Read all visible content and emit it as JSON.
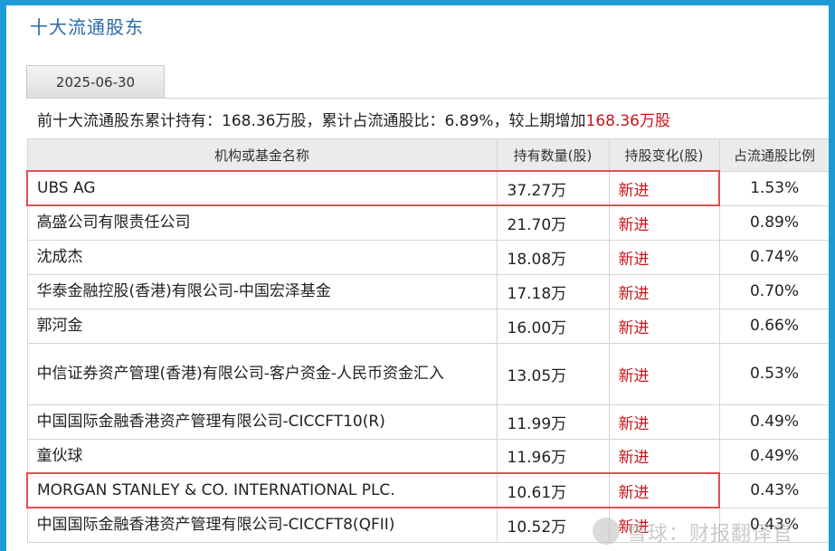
{
  "section_title": "十大流通股东",
  "tab_label": "2025-06-30",
  "summary": {
    "prefix": "前十大流通股东累计持有：168.36万股，累计占流通股比：6.89%，较上期增加",
    "highlight": "168.36万股"
  },
  "table": {
    "headers": [
      "机构或基金名称",
      "持有数量(股)",
      "持股变化(股)",
      "占流通股比例"
    ],
    "rows": [
      {
        "name": "UBS AG",
        "qty": "37.27万",
        "change": "新进",
        "pct": "1.53%"
      },
      {
        "name": "高盛公司有限责任公司",
        "qty": "21.70万",
        "change": "新进",
        "pct": "0.89%"
      },
      {
        "name": "沈成杰",
        "qty": "18.08万",
        "change": "新进",
        "pct": "0.74%"
      },
      {
        "name": "华泰金融控股(香港)有限公司-中国宏泽基金",
        "qty": "17.18万",
        "change": "新进",
        "pct": "0.70%"
      },
      {
        "name": "郭河金",
        "qty": "16.00万",
        "change": "新进",
        "pct": "0.66%"
      },
      {
        "name": "中信证券资产管理(香港)有限公司-客户资金-人民币资金汇入",
        "qty": "13.05万",
        "change": "新进",
        "pct": "0.53%"
      },
      {
        "name": "中国国际金融香港资产管理有限公司-CICCFT10(R)",
        "qty": "11.99万",
        "change": "新进",
        "pct": "0.49%"
      },
      {
        "name": "童伙球",
        "qty": "11.96万",
        "change": "新进",
        "pct": "0.49%"
      },
      {
        "name": "MORGAN STANLEY & CO. INTERNATIONAL PLC.",
        "qty": "10.61万",
        "change": "新进",
        "pct": "0.43%"
      },
      {
        "name": "中国国际金融香港资产管理有限公司-CICCFT8(QFII)",
        "qty": "10.52万",
        "change": "新进",
        "pct": "0.43%"
      }
    ]
  },
  "watermark": "雪球：财报翻译官",
  "colors": {
    "frame": "#1e9bd7",
    "title": "#2a6aa8",
    "accent_red": "#c8151b",
    "highlight_border": "#e05050"
  }
}
